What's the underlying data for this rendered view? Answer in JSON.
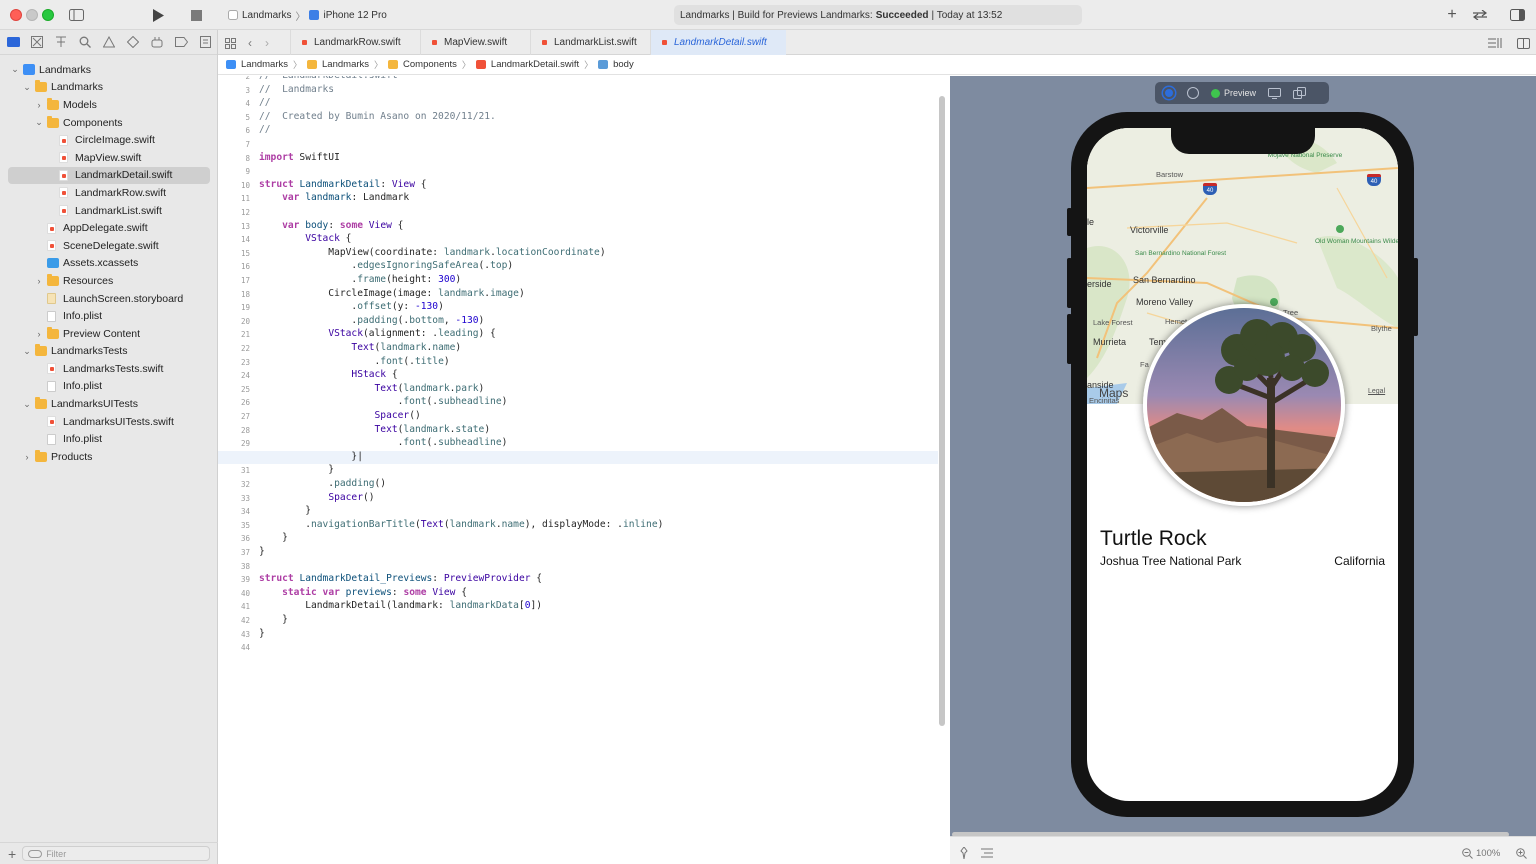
{
  "toolbar": {
    "scheme_target": "Landmarks",
    "scheme_device": "iPhone 12 Pro",
    "status_prefix": "Landmarks | Build for Previews Landmarks:",
    "status_result": "Succeeded",
    "status_suffix": "| Today at 13:52"
  },
  "navigator": {
    "items": [
      {
        "label": "Landmarks",
        "type": "proj",
        "depth": 0,
        "disclosure": "open"
      },
      {
        "label": "Landmarks",
        "type": "folder",
        "depth": 1,
        "disclosure": "open"
      },
      {
        "label": "Models",
        "type": "folder",
        "depth": 2,
        "disclosure": "closed"
      },
      {
        "label": "Components",
        "type": "folder",
        "depth": 2,
        "disclosure": "open"
      },
      {
        "label": "CircleImage.swift",
        "type": "swift",
        "depth": 3,
        "disclosure": ""
      },
      {
        "label": "MapView.swift",
        "type": "swift",
        "depth": 3,
        "disclosure": ""
      },
      {
        "label": "LandmarkDetail.swift",
        "type": "swift",
        "depth": 3,
        "disclosure": "",
        "selected": true
      },
      {
        "label": "LandmarkRow.swift",
        "type": "swift",
        "depth": 3,
        "disclosure": ""
      },
      {
        "label": "LandmarkList.swift",
        "type": "swift",
        "depth": 3,
        "disclosure": ""
      },
      {
        "label": "AppDelegate.swift",
        "type": "swift",
        "depth": 2,
        "disclosure": ""
      },
      {
        "label": "SceneDelegate.swift",
        "type": "swift",
        "depth": 2,
        "disclosure": ""
      },
      {
        "label": "Assets.xcassets",
        "type": "assets",
        "depth": 2,
        "disclosure": ""
      },
      {
        "label": "Resources",
        "type": "folder",
        "depth": 2,
        "disclosure": "closed"
      },
      {
        "label": "LaunchScreen.storyboard",
        "type": "sb",
        "depth": 2,
        "disclosure": ""
      },
      {
        "label": "Info.plist",
        "type": "plist",
        "depth": 2,
        "disclosure": ""
      },
      {
        "label": "Preview Content",
        "type": "folder",
        "depth": 2,
        "disclosure": "closed"
      },
      {
        "label": "LandmarksTests",
        "type": "folder",
        "depth": 1,
        "disclosure": "open"
      },
      {
        "label": "LandmarksTests.swift",
        "type": "swift",
        "depth": 2,
        "disclosure": ""
      },
      {
        "label": "Info.plist",
        "type": "plist",
        "depth": 2,
        "disclosure": ""
      },
      {
        "label": "LandmarksUITests",
        "type": "folder",
        "depth": 1,
        "disclosure": "open"
      },
      {
        "label": "LandmarksUITests.swift",
        "type": "swift",
        "depth": 2,
        "disclosure": ""
      },
      {
        "label": "Info.plist",
        "type": "plist",
        "depth": 2,
        "disclosure": ""
      },
      {
        "label": "Products",
        "type": "folder",
        "depth": 1,
        "disclosure": "closed"
      }
    ],
    "filter_placeholder": "Filter"
  },
  "tabs": [
    {
      "label": "LandmarkRow.swift",
      "active": false
    },
    {
      "label": "MapView.swift",
      "active": false
    },
    {
      "label": "LandmarkList.swift",
      "active": false
    },
    {
      "label": "LandmarkDetail.swift",
      "active": true
    }
  ],
  "jumpbar": [
    "Landmarks",
    "Landmarks",
    "Components",
    "LandmarkDetail.swift",
    "body"
  ],
  "code": {
    "first_line": 2,
    "current_line": 30,
    "lines": [
      "<span class=\"c\">//  LandmarkDetail.swift</span>",
      "<span class=\"c\">//  Landmarks</span>",
      "<span class=\"c\">//</span>",
      "<span class=\"c\">//  Created by Bumin Asano on 2020/11/21.</span>",
      "<span class=\"c\">//</span>",
      "",
      "<span class=\"k\">import</span> SwiftUI",
      "",
      "<span class=\"k\">struct</span> <span class=\"t2\">LandmarkDetail</span>: <span class=\"t\">View</span> {",
      "    <span class=\"k\">var</span> <span class=\"t2\">landmark</span>: Landmark",
      "",
      "    <span class=\"k\">var</span> <span class=\"t2\">body</span>: <span class=\"k\">some</span> <span class=\"t\">View</span> {",
      "        <span class=\"t\">VStack</span> {",
      "            MapView(coordinate: <span class=\"p\">landmark</span>.<span class=\"p\">locationCoordinate</span>)",
      "                .<span class=\"p\">edgesIgnoringSafeArea</span>(.<span class=\"p\">top</span>)",
      "                .<span class=\"p\">frame</span>(height: <span class=\"n\">300</span>)",
      "            CircleImage(image: <span class=\"p\">landmark</span>.<span class=\"p\">image</span>)",
      "                .<span class=\"p\">offset</span>(y: <span class=\"n\">-130</span>)",
      "                .<span class=\"p\">padding</span>(.<span class=\"p\">bottom</span>, <span class=\"n\">-130</span>)",
      "            <span class=\"t\">VStack</span>(alignment: .<span class=\"p\">leading</span>) {",
      "                <span class=\"t\">Text</span>(<span class=\"p\">landmark</span>.<span class=\"p\">name</span>)",
      "                    .<span class=\"p\">font</span>(.<span class=\"p\">title</span>)",
      "                <span class=\"t\">HStack</span> {",
      "                    <span class=\"t\">Text</span>(<span class=\"p\">landmark</span>.<span class=\"p\">park</span>)",
      "                        .<span class=\"p\">font</span>(.<span class=\"p\">subheadline</span>)",
      "                    <span class=\"t\">Spacer</span>()",
      "                    <span class=\"t\">Text</span>(<span class=\"p\">landmark</span>.<span class=\"p\">state</span>)",
      "                        .<span class=\"p\">font</span>(.<span class=\"p\">subheadline</span>)",
      "                }|",
      "            }",
      "            .<span class=\"p\">padding</span>()",
      "            <span class=\"t\">Spacer</span>()",
      "        }",
      "        .<span class=\"p\">navigationBarTitle</span>(<span class=\"t\">Text</span>(<span class=\"p\">landmark</span>.<span class=\"p\">name</span>), displayMode: .<span class=\"p\">inline</span>)",
      "    }",
      "}",
      "",
      "<span class=\"k\">struct</span> <span class=\"t2\">LandmarkDetail_Previews</span>: <span class=\"t\">PreviewProvider</span> {",
      "    <span class=\"k\">static</span> <span class=\"k\">var</span> <span class=\"t2\">previews</span>: <span class=\"k\">some</span> <span class=\"t\">View</span> {",
      "        LandmarkDetail(landmark: <span class=\"p\">landmarkData</span>[<span class=\"n\">0</span>])",
      "    }",
      "}",
      ""
    ]
  },
  "preview": {
    "toolbar_label": "Preview",
    "landmark_name": "Turtle Rock",
    "park": "Joshua Tree National Park",
    "state": "California",
    "map_labels": {
      "mojave": "Mojave National Preserve",
      "barstow": "Barstow",
      "victorville": "Victorville",
      "le": "le",
      "old_woman": "Old Woman Mountains Wilderness",
      "sb_forest": "San Bernardino National Forest",
      "san_bernardino": "San Bernardino",
      "erside": "erside",
      "moreno": "Moreno Valley",
      "lake_forest": "Lake Forest",
      "hemet": "Hemet",
      "murrieta": "Murrieta",
      "tem": "Tem",
      "blythe": "Blythe",
      "tree": "Tree",
      "maps": "Maps",
      "legal": "Legal",
      "anside": "anside",
      "encinitas": "Encinitas",
      "fa": "Fa",
      "i40": "40"
    },
    "zoom": "100%"
  },
  "colors": {
    "accent": "#2b66d9",
    "canvas": "#7e8ba0",
    "status_ok": "#3fc54e"
  }
}
